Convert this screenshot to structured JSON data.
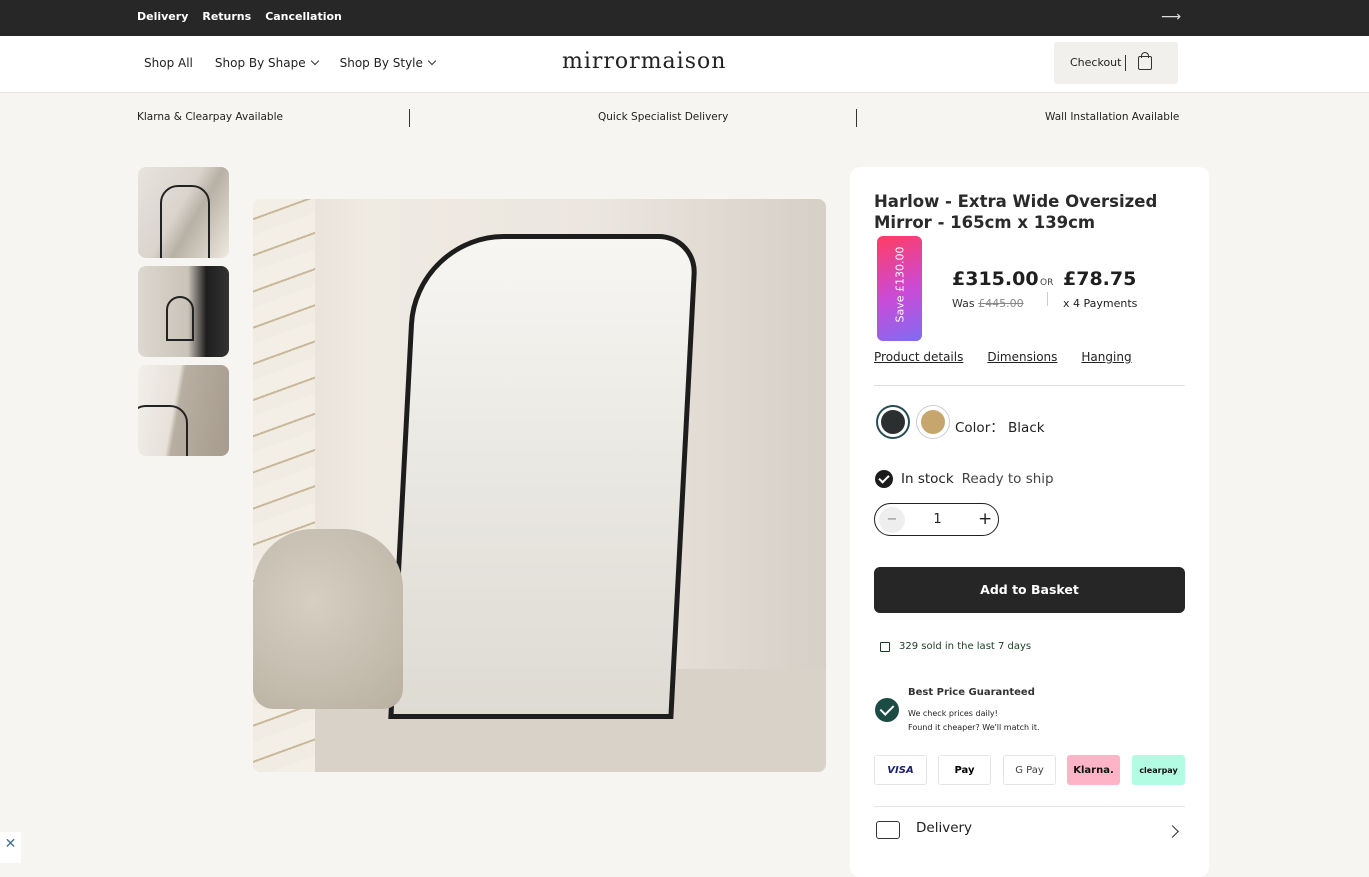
{
  "topbar": {
    "links": [
      "Delivery",
      "Returns",
      "Cancellation"
    ],
    "arrow_icon": "arrow-right"
  },
  "nav": {
    "shop_all": "Shop All",
    "shop_shape": "Shop By Shape",
    "shop_style": "Shop By Style"
  },
  "logo": "mirrormaison",
  "checkout": {
    "label": "Checkout",
    "icon": "shopping-bag"
  },
  "usps": [
    "Klarna & Clearpay Available",
    "Quick Specialist Delivery",
    "Wall Installation Available"
  ],
  "product": {
    "title": "Harlow - Extra Wide Oversized Mirror - 165cm x 139cm",
    "badge": "Save £130.00",
    "price": "£315.00",
    "was_label": "Was",
    "was_price": "£445.00",
    "or": "OR",
    "installment": "£78.75",
    "installment_sub": "x 4 Payments",
    "tabs": [
      "Product details",
      "Dimensions",
      "Hanging"
    ],
    "color_label": "Color：",
    "color_value": "Black",
    "swatch_colors": [
      "#2b2f2f",
      "#c6a66d"
    ],
    "stock_label": "In stock",
    "stock_status": "Ready to ship",
    "quantity": "1",
    "add_button": "Add to Basket",
    "sold_text": "329 sold in the last 7 days",
    "guarantee_title": "Best Price Guaranteed",
    "guarantee_line1": "We check prices daily!",
    "guarantee_line2": "Found it cheaper? We'll match it.",
    "payments": [
      "VISA",
      "Pay",
      "G Pay",
      "Klarna.",
      "clearpay"
    ],
    "delivery_label": "Delivery"
  }
}
